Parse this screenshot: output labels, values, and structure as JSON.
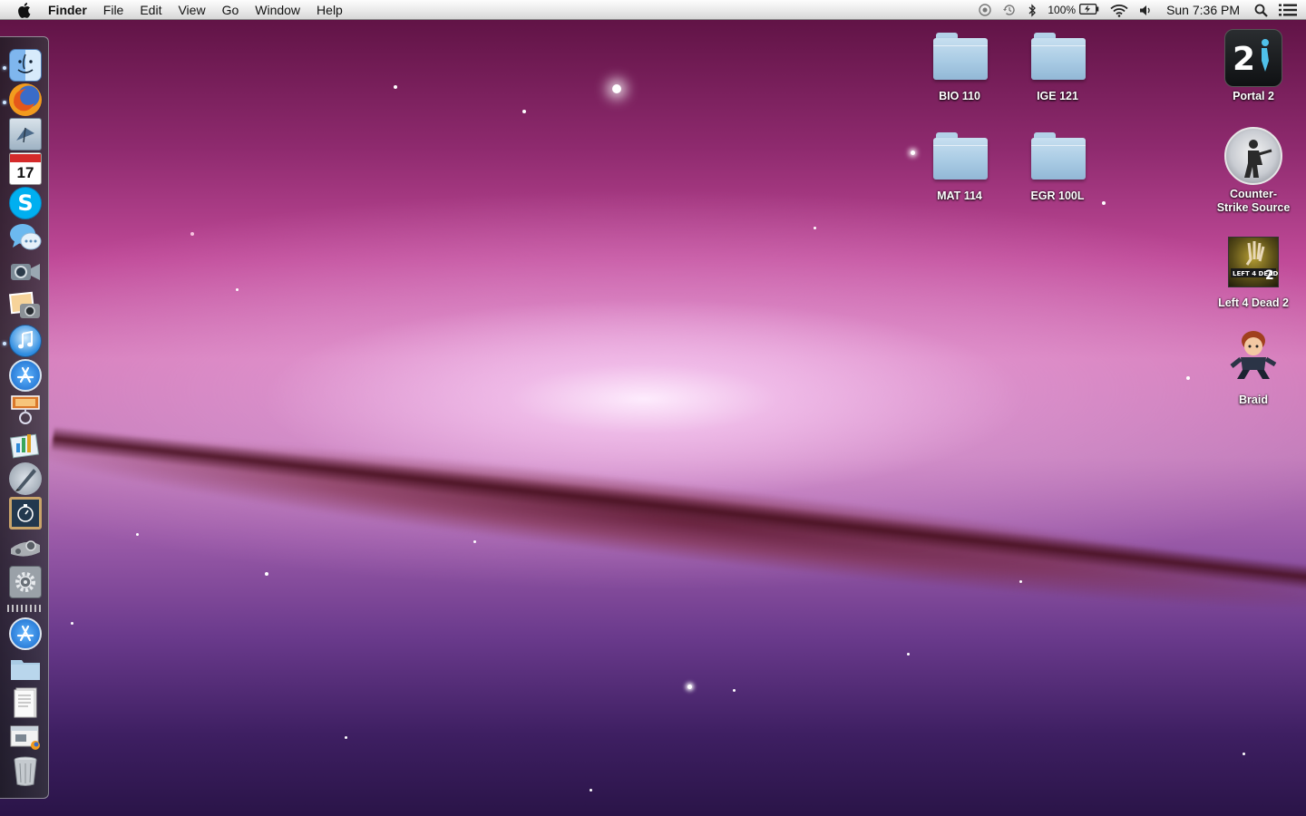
{
  "menubar": {
    "app_name": "Finder",
    "menus": [
      "File",
      "Edit",
      "View",
      "Go",
      "Window",
      "Help"
    ],
    "battery_percent": "100%",
    "clock": "Sun 7:36 PM"
  },
  "dock": {
    "items": [
      {
        "name": "Finder",
        "icon": "finder-icon",
        "running": true
      },
      {
        "name": "Firefox",
        "icon": "firefox-icon",
        "running": true
      },
      {
        "name": "Mail",
        "icon": "mail-icon",
        "running": false
      },
      {
        "name": "iCal",
        "icon": "calendar-icon",
        "running": false,
        "text": "17"
      },
      {
        "name": "Skype",
        "icon": "skype-icon",
        "running": false
      },
      {
        "name": "iChat",
        "icon": "ichat-icon",
        "running": false
      },
      {
        "name": "FaceTime",
        "icon": "facetime-icon",
        "running": false
      },
      {
        "name": "iPhoto",
        "icon": "iphoto-icon",
        "running": false
      },
      {
        "name": "iTunes",
        "icon": "itunes-icon",
        "running": true
      },
      {
        "name": "App Store",
        "icon": "app-store-icon",
        "running": false
      },
      {
        "name": "Preview",
        "icon": "preview-icon",
        "running": false
      },
      {
        "name": "Keynote",
        "icon": "keynote-icon",
        "running": false
      },
      {
        "name": "Pen Tool",
        "icon": "pen-tool-icon",
        "running": false
      },
      {
        "name": "Time Machine",
        "icon": "clock-board-icon",
        "running": false
      },
      {
        "name": "Steam",
        "icon": "steam-icon",
        "running": false
      },
      {
        "name": "System Preferences",
        "icon": "system-preferences-icon",
        "running": false
      },
      {
        "name": "Applications",
        "icon": "applications-stack-icon",
        "running": false
      },
      {
        "name": "Documents",
        "icon": "documents-folder-icon",
        "running": false
      },
      {
        "name": "Downloads",
        "icon": "document-stack-icon",
        "running": false
      },
      {
        "name": "Web Page",
        "icon": "web-document-icon",
        "running": false
      },
      {
        "name": "Trash",
        "icon": "trash-icon",
        "running": false
      }
    ]
  },
  "desktop": {
    "folders": [
      {
        "label": "BIO 110"
      },
      {
        "label": "IGE 121"
      },
      {
        "label": "MAT 114"
      },
      {
        "label": "EGR 100L"
      }
    ],
    "apps": [
      {
        "label": "Portal 2",
        "icon": "portal-2-icon"
      },
      {
        "label": "Counter-\nStrike Source",
        "line1": "Counter-",
        "line2": "Strike Source",
        "icon": "counter-strike-icon"
      },
      {
        "label": "Left 4 Dead 2",
        "icon": "left-4-dead-2-icon"
      },
      {
        "label": "Braid",
        "icon": "braid-icon"
      }
    ]
  },
  "colors": {
    "menubar_bg": "#e8e8e8",
    "folder_blue": "#a9cbe4",
    "wallpaper_magenta": "#c04a98"
  }
}
